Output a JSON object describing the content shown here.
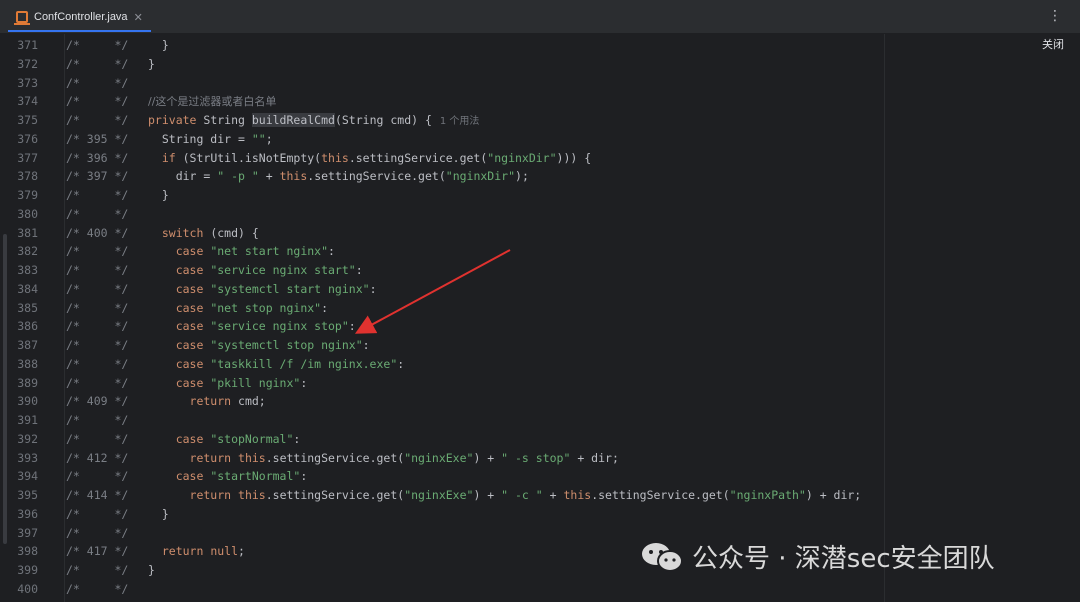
{
  "tab": {
    "label": "ConfController.java",
    "close": "✕"
  },
  "menu_icon": "⋮",
  "close_label": "关闭",
  "watermark": "公众号 · 深潜sec安全团队",
  "lines": [
    {
      "n": "371",
      "g": "/*     */",
      "code": [
        {
          "t": "  }",
          "c": ""
        }
      ]
    },
    {
      "n": "372",
      "g": "/*     */",
      "code": [
        {
          "t": "}",
          "c": ""
        }
      ]
    },
    {
      "n": "373",
      "g": "/*     */",
      "code": []
    },
    {
      "n": "374",
      "g": "/*     */",
      "code": [
        {
          "t": "//这个是过滤器或者白名单",
          "c": "cm"
        }
      ]
    },
    {
      "n": "375",
      "g": "/*     */",
      "code": [
        {
          "t": "private ",
          "c": "kw"
        },
        {
          "t": "String ",
          "c": ""
        },
        {
          "t": "buildRealCmd",
          "c": "hl"
        },
        {
          "t": "(String cmd) {",
          "c": ""
        },
        {
          "t": "1 个用法",
          "c": "hint"
        }
      ]
    },
    {
      "n": "376",
      "g": "/* 395 */",
      "code": [
        {
          "t": "  String dir = ",
          "c": ""
        },
        {
          "t": "\"\"",
          "c": "str"
        },
        {
          "t": ";",
          "c": ""
        }
      ]
    },
    {
      "n": "377",
      "g": "/* 396 */",
      "code": [
        {
          "t": "  if ",
          "c": "kw"
        },
        {
          "t": "(StrUtil.isNotEmpty(",
          "c": ""
        },
        {
          "t": "this",
          "c": "kw"
        },
        {
          "t": ".settingService.get(",
          "c": ""
        },
        {
          "t": "\"nginxDir\"",
          "c": "str"
        },
        {
          "t": "))) {",
          "c": ""
        }
      ]
    },
    {
      "n": "378",
      "g": "/* 397 */",
      "code": [
        {
          "t": "    dir = ",
          "c": ""
        },
        {
          "t": "\" -p \"",
          "c": "str"
        },
        {
          "t": " + ",
          "c": ""
        },
        {
          "t": "this",
          "c": "kw"
        },
        {
          "t": ".settingService.get(",
          "c": ""
        },
        {
          "t": "\"nginxDir\"",
          "c": "str"
        },
        {
          "t": ");",
          "c": ""
        }
      ]
    },
    {
      "n": "379",
      "g": "/*     */",
      "code": [
        {
          "t": "  }",
          "c": ""
        }
      ]
    },
    {
      "n": "380",
      "g": "/*     */",
      "code": []
    },
    {
      "n": "381",
      "g": "/* 400 */",
      "code": [
        {
          "t": "  switch ",
          "c": "kw"
        },
        {
          "t": "(cmd) {",
          "c": ""
        }
      ]
    },
    {
      "n": "382",
      "g": "/*     */",
      "code": [
        {
          "t": "    case ",
          "c": "kw"
        },
        {
          "t": "\"net start nginx\"",
          "c": "str"
        },
        {
          "t": ":",
          "c": ""
        }
      ]
    },
    {
      "n": "383",
      "g": "/*     */",
      "code": [
        {
          "t": "    case ",
          "c": "kw"
        },
        {
          "t": "\"service nginx start\"",
          "c": "str"
        },
        {
          "t": ":",
          "c": ""
        }
      ]
    },
    {
      "n": "384",
      "g": "/*     */",
      "code": [
        {
          "t": "    case ",
          "c": "kw"
        },
        {
          "t": "\"systemctl start nginx\"",
          "c": "str"
        },
        {
          "t": ":",
          "c": ""
        }
      ]
    },
    {
      "n": "385",
      "g": "/*     */",
      "code": [
        {
          "t": "    case ",
          "c": "kw"
        },
        {
          "t": "\"net stop nginx\"",
          "c": "str"
        },
        {
          "t": ":",
          "c": ""
        }
      ]
    },
    {
      "n": "386",
      "g": "/*     */",
      "code": [
        {
          "t": "    case ",
          "c": "kw"
        },
        {
          "t": "\"service nginx stop\"",
          "c": "str"
        },
        {
          "t": ":",
          "c": ""
        }
      ]
    },
    {
      "n": "387",
      "g": "/*     */",
      "code": [
        {
          "t": "    case ",
          "c": "kw"
        },
        {
          "t": "\"systemctl stop nginx\"",
          "c": "str"
        },
        {
          "t": ":",
          "c": ""
        }
      ]
    },
    {
      "n": "388",
      "g": "/*     */",
      "code": [
        {
          "t": "    case ",
          "c": "kw"
        },
        {
          "t": "\"taskkill /f /im nginx.exe\"",
          "c": "str"
        },
        {
          "t": ":",
          "c": ""
        }
      ]
    },
    {
      "n": "389",
      "g": "/*     */",
      "code": [
        {
          "t": "    case ",
          "c": "kw"
        },
        {
          "t": "\"pkill nginx\"",
          "c": "str"
        },
        {
          "t": ":",
          "c": ""
        }
      ]
    },
    {
      "n": "390",
      "g": "/* 409 */",
      "code": [
        {
          "t": "      return ",
          "c": "kw"
        },
        {
          "t": "cmd;",
          "c": ""
        }
      ]
    },
    {
      "n": "391",
      "g": "/*     */",
      "code": []
    },
    {
      "n": "392",
      "g": "/*     */",
      "code": [
        {
          "t": "    case ",
          "c": "kw"
        },
        {
          "t": "\"stopNormal\"",
          "c": "str"
        },
        {
          "t": ":",
          "c": ""
        }
      ]
    },
    {
      "n": "393",
      "g": "/* 412 */",
      "code": [
        {
          "t": "      return ",
          "c": "kw"
        },
        {
          "t": "this",
          "c": "kw"
        },
        {
          "t": ".settingService.get(",
          "c": ""
        },
        {
          "t": "\"nginxExe\"",
          "c": "str"
        },
        {
          "t": ") + ",
          "c": ""
        },
        {
          "t": "\" -s stop\"",
          "c": "str"
        },
        {
          "t": " + dir;",
          "c": ""
        }
      ]
    },
    {
      "n": "394",
      "g": "/*     */",
      "code": [
        {
          "t": "    case ",
          "c": "kw"
        },
        {
          "t": "\"startNormal\"",
          "c": "str"
        },
        {
          "t": ":",
          "c": ""
        }
      ]
    },
    {
      "n": "395",
      "g": "/* 414 */",
      "code": [
        {
          "t": "      return ",
          "c": "kw"
        },
        {
          "t": "this",
          "c": "kw"
        },
        {
          "t": ".settingService.get(",
          "c": ""
        },
        {
          "t": "\"nginxExe\"",
          "c": "str"
        },
        {
          "t": ") + ",
          "c": ""
        },
        {
          "t": "\" -c \"",
          "c": "str"
        },
        {
          "t": " + ",
          "c": ""
        },
        {
          "t": "this",
          "c": "kw"
        },
        {
          "t": ".settingService.get(",
          "c": ""
        },
        {
          "t": "\"nginxPath\"",
          "c": "str"
        },
        {
          "t": ") + dir;",
          "c": ""
        }
      ]
    },
    {
      "n": "396",
      "g": "/*     */",
      "code": [
        {
          "t": "  }",
          "c": ""
        }
      ]
    },
    {
      "n": "397",
      "g": "/*     */",
      "code": []
    },
    {
      "n": "398",
      "g": "/* 417 */",
      "code": [
        {
          "t": "  return ",
          "c": "kw"
        },
        {
          "t": "null",
          "c": "kw"
        },
        {
          "t": ";",
          "c": ""
        }
      ]
    },
    {
      "n": "399",
      "g": "/*     */",
      "code": [
        {
          "t": "}",
          "c": ""
        }
      ]
    },
    {
      "n": "400",
      "g": "/*     */",
      "code": []
    }
  ]
}
